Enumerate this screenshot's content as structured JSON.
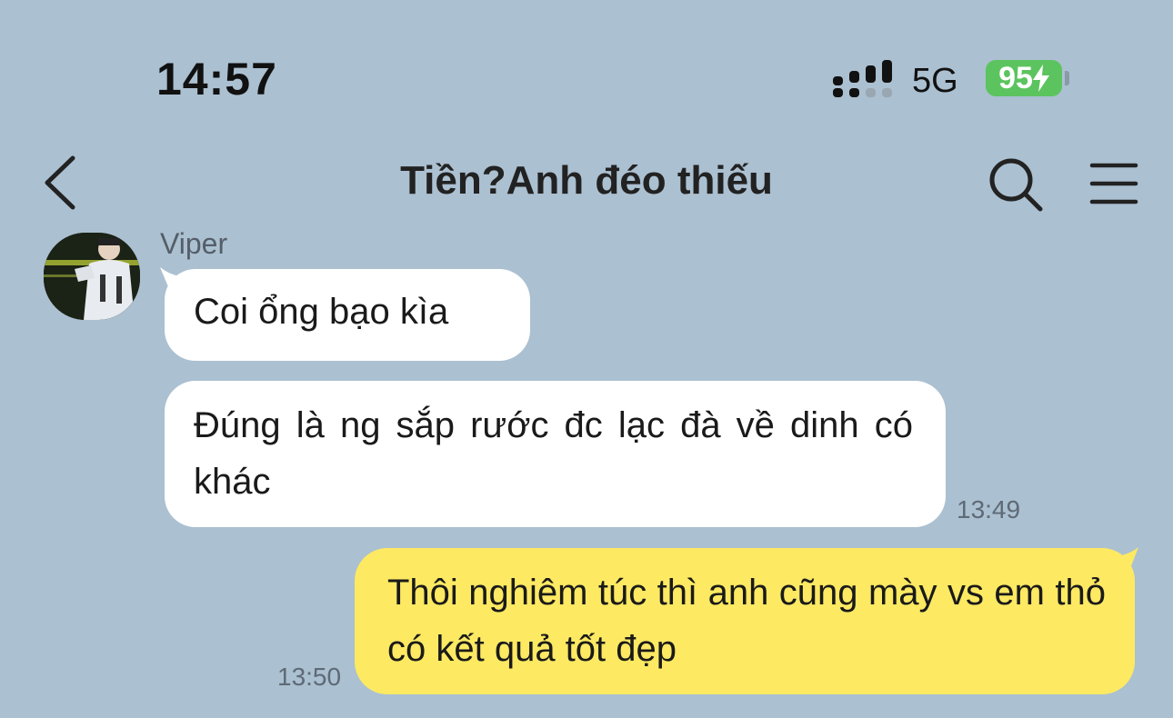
{
  "status_bar": {
    "time": "14:57",
    "network": "5G",
    "battery": "95",
    "battery_color": "#5cc45f"
  },
  "header": {
    "title": "Tiền?Anh đéo thiếu",
    "back_icon": "chevron-left-icon",
    "search_icon": "search-icon",
    "menu_icon": "hamburger-menu-icon"
  },
  "messages": [
    {
      "sender": "Viper",
      "text": "Coi ổng bạo kìa",
      "direction": "incoming"
    },
    {
      "text": "Đúng là ng sắp rước đc lạc đà về dinh có khác",
      "direction": "incoming",
      "time": "13:49"
    },
    {
      "text": "Thôi nghiêm túc thì anh cũng mày vs em thỏ có kết quả tốt đẹp",
      "direction": "outgoing",
      "time": "13:50"
    }
  ],
  "colors": {
    "background": "#abc0d1",
    "incoming_bubble": "#ffffff",
    "outgoing_bubble": "#fde962"
  }
}
